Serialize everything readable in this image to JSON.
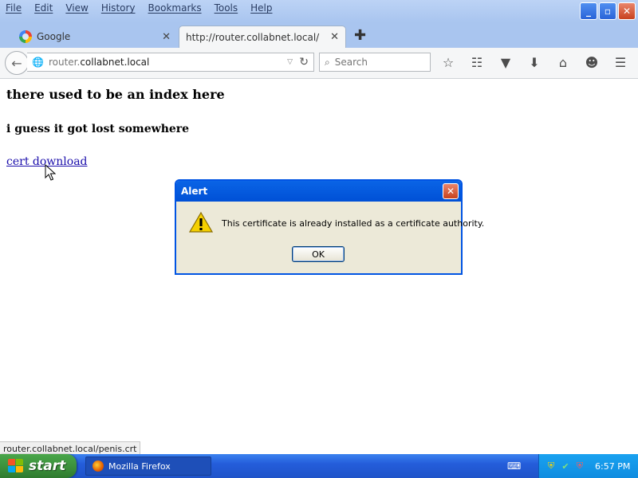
{
  "menu": {
    "items": [
      {
        "label": "File"
      },
      {
        "label": "Edit"
      },
      {
        "label": "View"
      },
      {
        "label": "History"
      },
      {
        "label": "Bookmarks"
      },
      {
        "label": "Tools"
      },
      {
        "label": "Help"
      }
    ]
  },
  "window_controls": {
    "minimize": "_",
    "maximize": "▫",
    "close": "✕"
  },
  "tabs": [
    {
      "label": "Google",
      "icon": "google-icon",
      "active": false
    },
    {
      "label": "http://router.collabnet.local/",
      "active": true
    }
  ],
  "navbar": {
    "url_prefix": "router.",
    "url_domain": "collabnet.local",
    "search_placeholder": "Search"
  },
  "page": {
    "heading1": "there used to be an index here",
    "heading2": "i guess it got lost somewhere",
    "link_text": "cert download"
  },
  "alert": {
    "title": "Alert",
    "message": "This certificate is already installed as a certificate authority.",
    "ok_label": "OK"
  },
  "status": {
    "text": "router.collabnet.local/penis.crt"
  },
  "taskbar": {
    "start_label": "start",
    "task_label": "Mozilla Firefox",
    "clock": "6:57 PM"
  },
  "colors": {
    "link": "#1a0dab",
    "dialog_title": "#0a64e6",
    "taskbar": "#245ddb",
    "start_button": "#3a8e3a"
  }
}
